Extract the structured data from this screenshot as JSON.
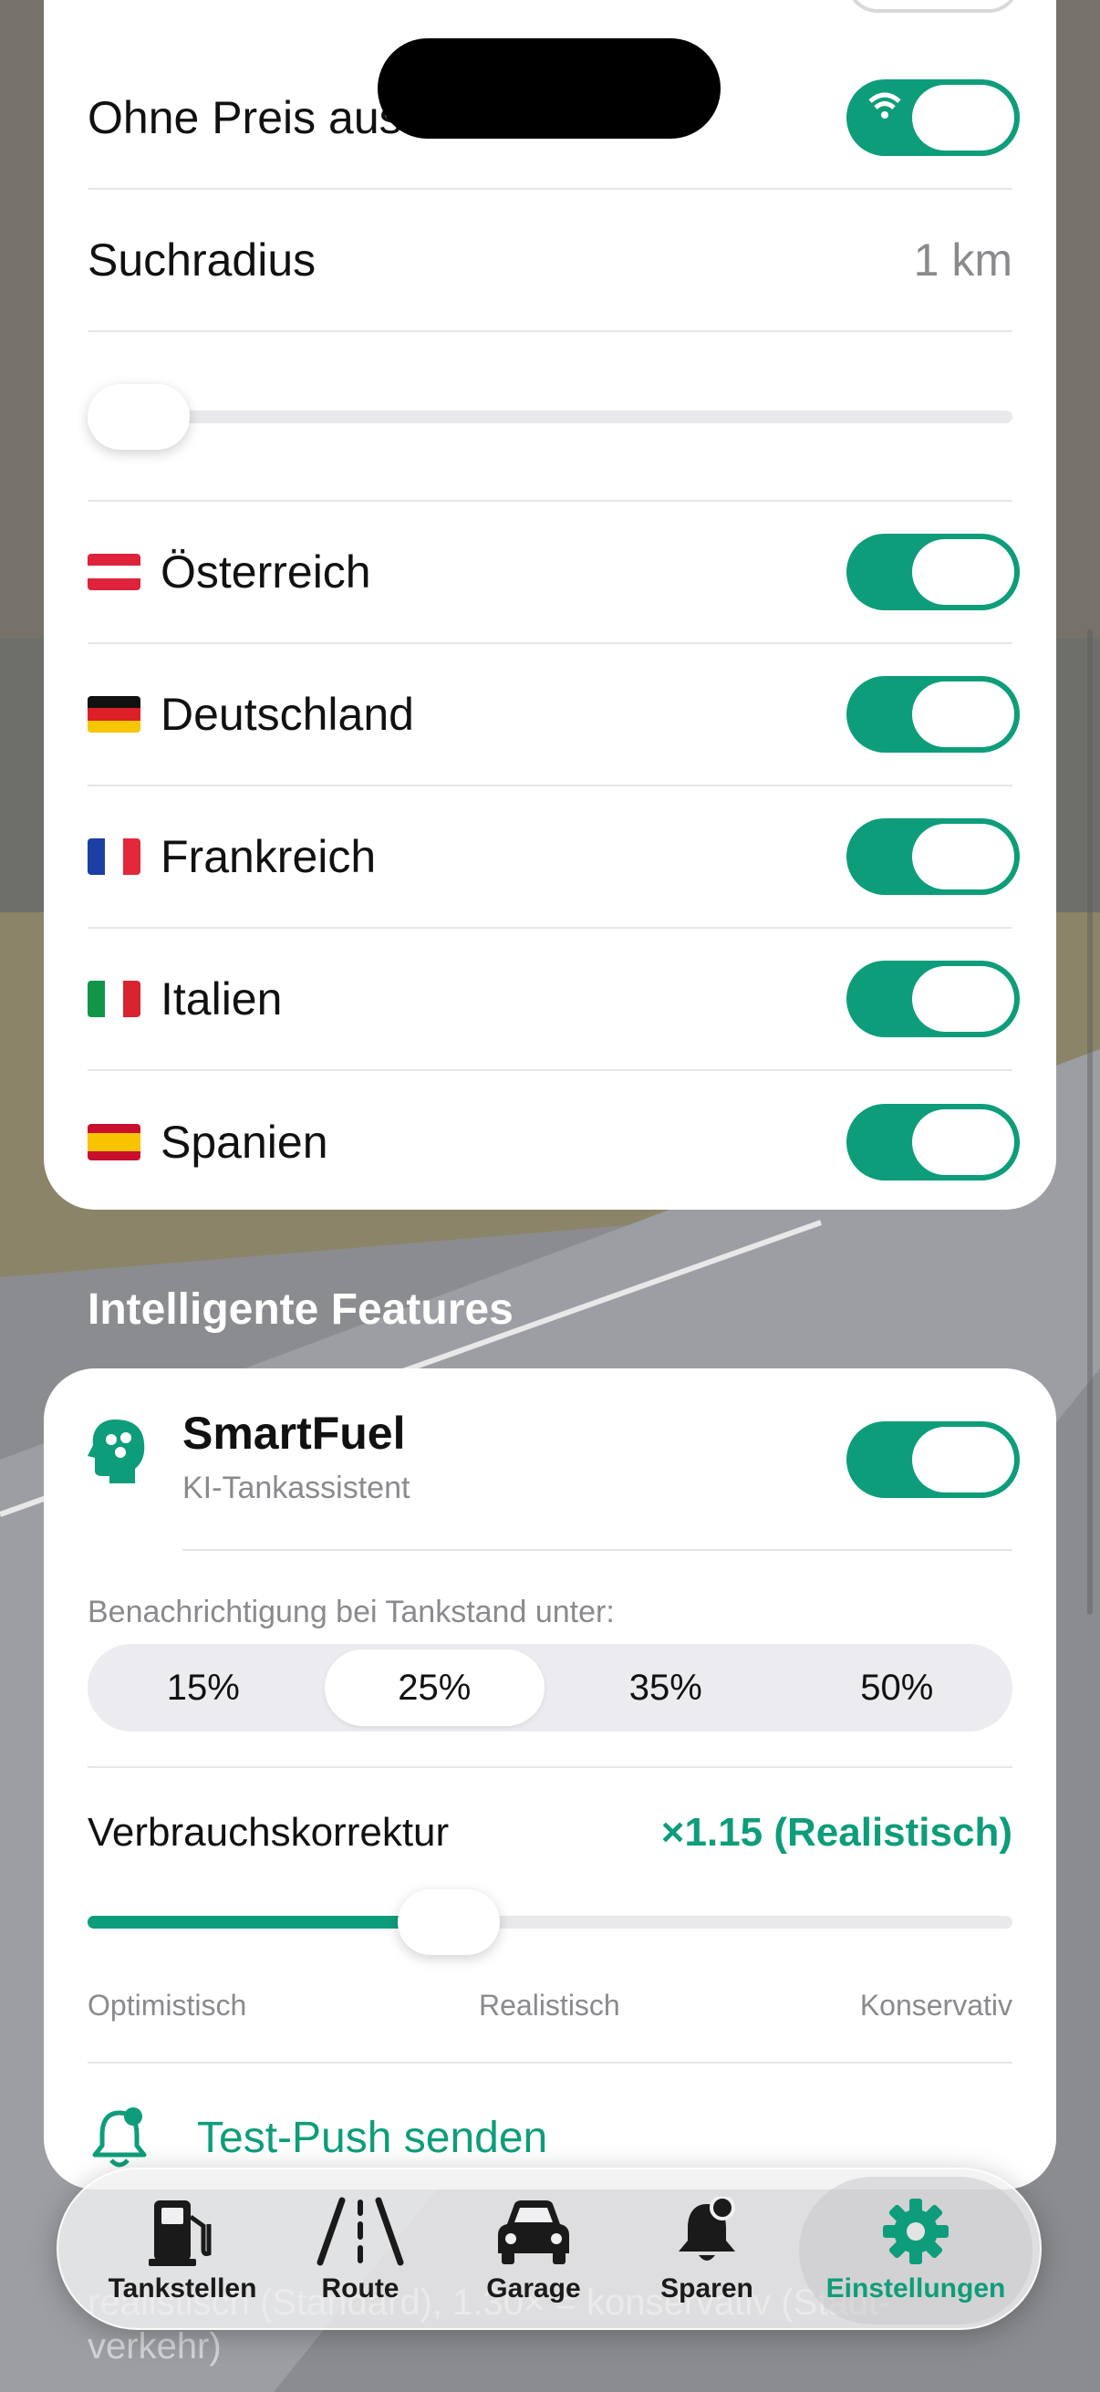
{
  "filters": {
    "hide_no_price_label": "Ohne Preis aus",
    "radius_label": "Suchradius",
    "radius_value": "1 km",
    "radius_slider_level": 0
  },
  "countries": [
    {
      "label": "Österreich",
      "flag": "AT",
      "enabled": true
    },
    {
      "label": "Deutschland",
      "flag": "DE",
      "enabled": true
    },
    {
      "label": "Frankreich",
      "flag": "FR",
      "enabled": true
    },
    {
      "label": "Italien",
      "flag": "IT",
      "enabled": true
    },
    {
      "label": "Spanien",
      "flag": "ES",
      "enabled": true
    }
  ],
  "features": {
    "section_title": "Intelligente Features",
    "smartfuel_title": "SmartFuel",
    "smartfuel_subtitle": "KI-Tankassistent",
    "smartfuel_enabled": true,
    "notify_label": "Benachrichtigung bei Tankstand unter:",
    "notify_options": [
      "15%",
      "25%",
      "35%",
      "50%"
    ],
    "notify_selected": "25%",
    "consumption_label": "Verbrauchskorrektur",
    "consumption_value": "×1.15 (Realistisch)",
    "consumption_slider_level": 0.39,
    "scale_min": "Optimistisch",
    "scale_mid": "Realistisch",
    "scale_max": "Konservativ",
    "test_push_label": "Test-Push senden"
  },
  "footer_text": "realistisch (Standard), 1.30× = konservativ (Stadt-verkehr)",
  "tabs": [
    {
      "label": "Tankstellen",
      "icon": "fuel-pump-icon"
    },
    {
      "label": "Route",
      "icon": "road-icon"
    },
    {
      "label": "Garage",
      "icon": "car-icon"
    },
    {
      "label": "Sparen",
      "icon": "bell-icon"
    },
    {
      "label": "Einstellungen",
      "icon": "gear-icon",
      "active": true
    }
  ],
  "colors": {
    "accent": "#0e9d7a",
    "text": "#111111",
    "secondary": "#8a8a8e"
  }
}
